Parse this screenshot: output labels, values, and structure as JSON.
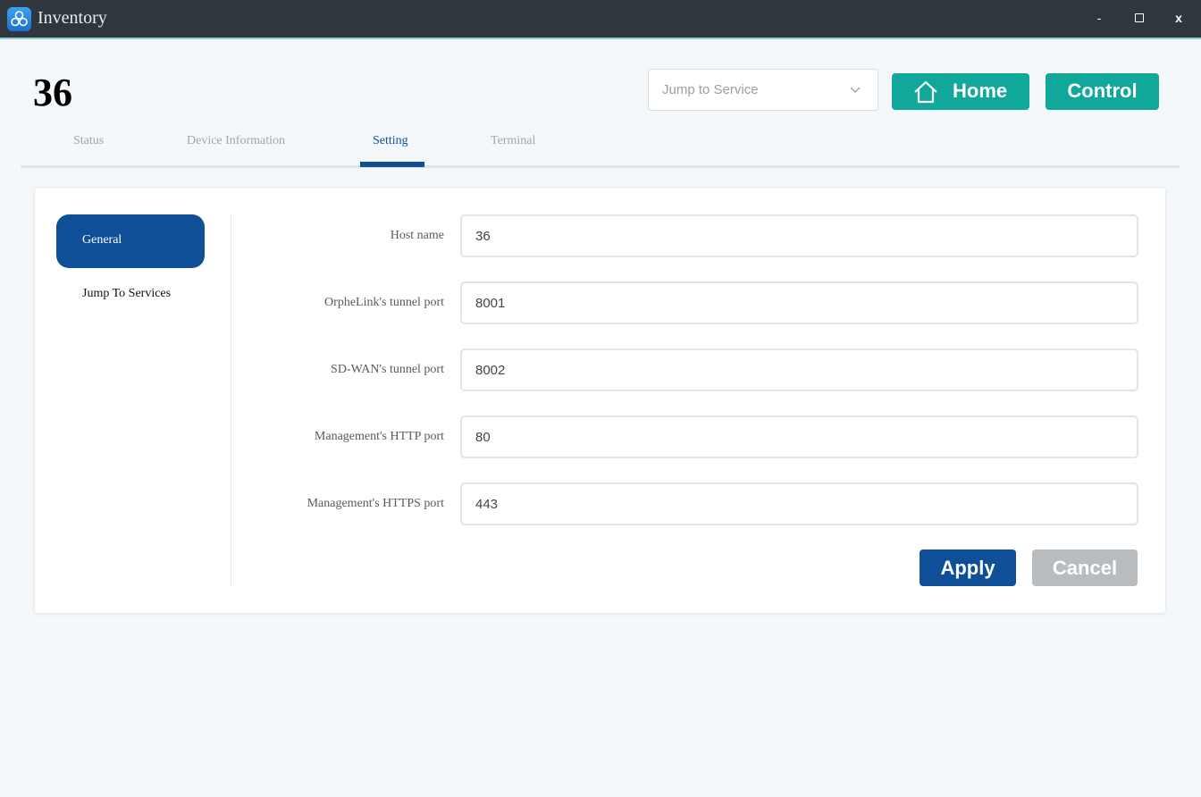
{
  "window": {
    "title": "Inventory",
    "icon": "app-logo-icon",
    "controls": {
      "minimize": "-",
      "close": "x"
    }
  },
  "header": {
    "device_title": "36",
    "jump_select": {
      "placeholder": "Jump to Service"
    },
    "home_label": "Home",
    "control_label": "Control"
  },
  "tabs": [
    {
      "label": "Status",
      "active": false
    },
    {
      "label": "Device Information",
      "active": false
    },
    {
      "label": "Setting",
      "active": true
    },
    {
      "label": "Terminal",
      "active": false
    }
  ],
  "sidebar": {
    "items": [
      {
        "label": "General",
        "active": true
      },
      {
        "label": "Jump To Services",
        "active": false
      }
    ]
  },
  "form": {
    "fields": [
      {
        "label": "Host name",
        "value": "36"
      },
      {
        "label": "OrpheLink's tunnel port",
        "value": "8001"
      },
      {
        "label": "SD-WAN's tunnel port",
        "value": "8002"
      },
      {
        "label": "Management's HTTP port",
        "value": "80"
      },
      {
        "label": "Management's HTTPS port",
        "value": "443"
      }
    ],
    "apply_label": "Apply",
    "cancel_label": "Cancel"
  },
  "colors": {
    "titlebar": "#30363d",
    "accent_teal": "#10a89b",
    "primary_blue": "#0e4f97",
    "disabled_gray": "#b9bcbf",
    "background": "#f4f8fb"
  }
}
